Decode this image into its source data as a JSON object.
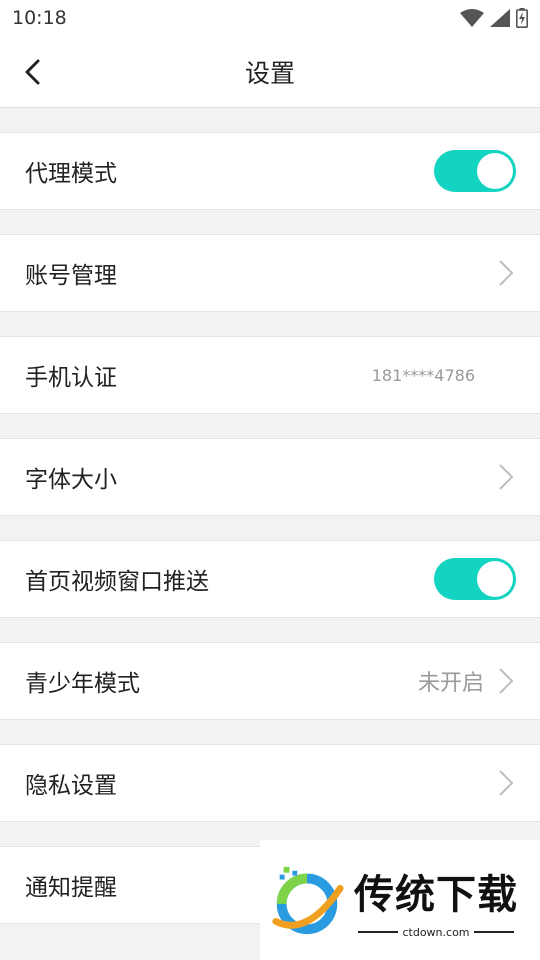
{
  "status_bar": {
    "time": "10:18",
    "icons": [
      "wifi-icon",
      "cellular-signal-icon",
      "battery-charging-icon"
    ]
  },
  "nav": {
    "title": "设置",
    "back_icon": "chevron-left-icon"
  },
  "settings": {
    "proxy_mode": {
      "label": "代理模式",
      "toggle_on": true
    },
    "account": {
      "label": "账号管理",
      "icon": "chevron-right-icon"
    },
    "phone": {
      "label": "手机认证",
      "value": "181****4786"
    },
    "font_size": {
      "label": "字体大小",
      "icon": "chevron-right-icon"
    },
    "home_push": {
      "label": "首页视频窗口推送",
      "toggle_on": true
    },
    "teen_mode": {
      "label": "青少年模式",
      "value": "未开启",
      "icon": "chevron-right-icon"
    },
    "privacy": {
      "label": "隐私设置",
      "icon": "chevron-right-icon"
    },
    "notify": {
      "label": "通知提醒"
    }
  },
  "watermark": {
    "title": "传统下载",
    "subtitle": "ctdown.com"
  },
  "colors": {
    "accent": "#13d3c1",
    "background": "#f2f2f4",
    "row": "#ffffff"
  }
}
